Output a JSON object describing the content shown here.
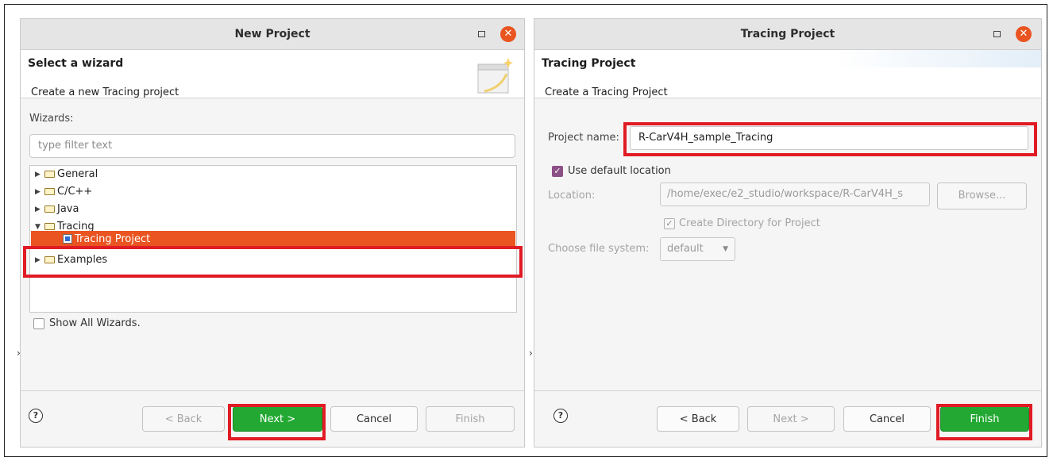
{
  "dialog1": {
    "title": "New Project",
    "header_title": "Select a wizard",
    "header_desc": "Create a new Tracing project",
    "wizards_label": "Wizards:",
    "filter_placeholder": "type filter text",
    "tree": [
      {
        "label": "General",
        "expanded": false
      },
      {
        "label": "C/C++",
        "expanded": false
      },
      {
        "label": "Java",
        "expanded": false
      },
      {
        "label": "Tracing",
        "expanded": true
      },
      {
        "label": "Tracing Project",
        "child": true,
        "selected": true
      },
      {
        "label": "Examples",
        "expanded": false
      }
    ],
    "show_all_label": "Show All Wizards.",
    "buttons": {
      "back": "< Back",
      "next": "Next >",
      "cancel": "Cancel",
      "finish": "Finish"
    }
  },
  "dialog2": {
    "title": "Tracing Project",
    "header_title": "Tracing Project",
    "header_desc": "Create a Tracing Project",
    "project_name_label": "Project name:",
    "project_name_value": "R-CarV4H_sample_Tracing",
    "use_default_label": "Use default location",
    "location_label": "Location:",
    "location_value": "/home/exec/e2_studio/workspace/R-CarV4H_s",
    "browse_label": "Browse...",
    "create_dir_label": "Create Directory for Project",
    "file_system_label": "Choose file system:",
    "file_system_value": "default",
    "buttons": {
      "back": "< Back",
      "next": "Next >",
      "cancel": "Cancel",
      "finish": "Finish"
    }
  },
  "colors": {
    "accent": "#e95420",
    "primary_button": "#23a933",
    "highlight_box": "#e01b24"
  },
  "icons": {
    "help": "help-icon",
    "close": "close-icon",
    "maximize": "maximize-icon",
    "folder": "folder-icon"
  }
}
